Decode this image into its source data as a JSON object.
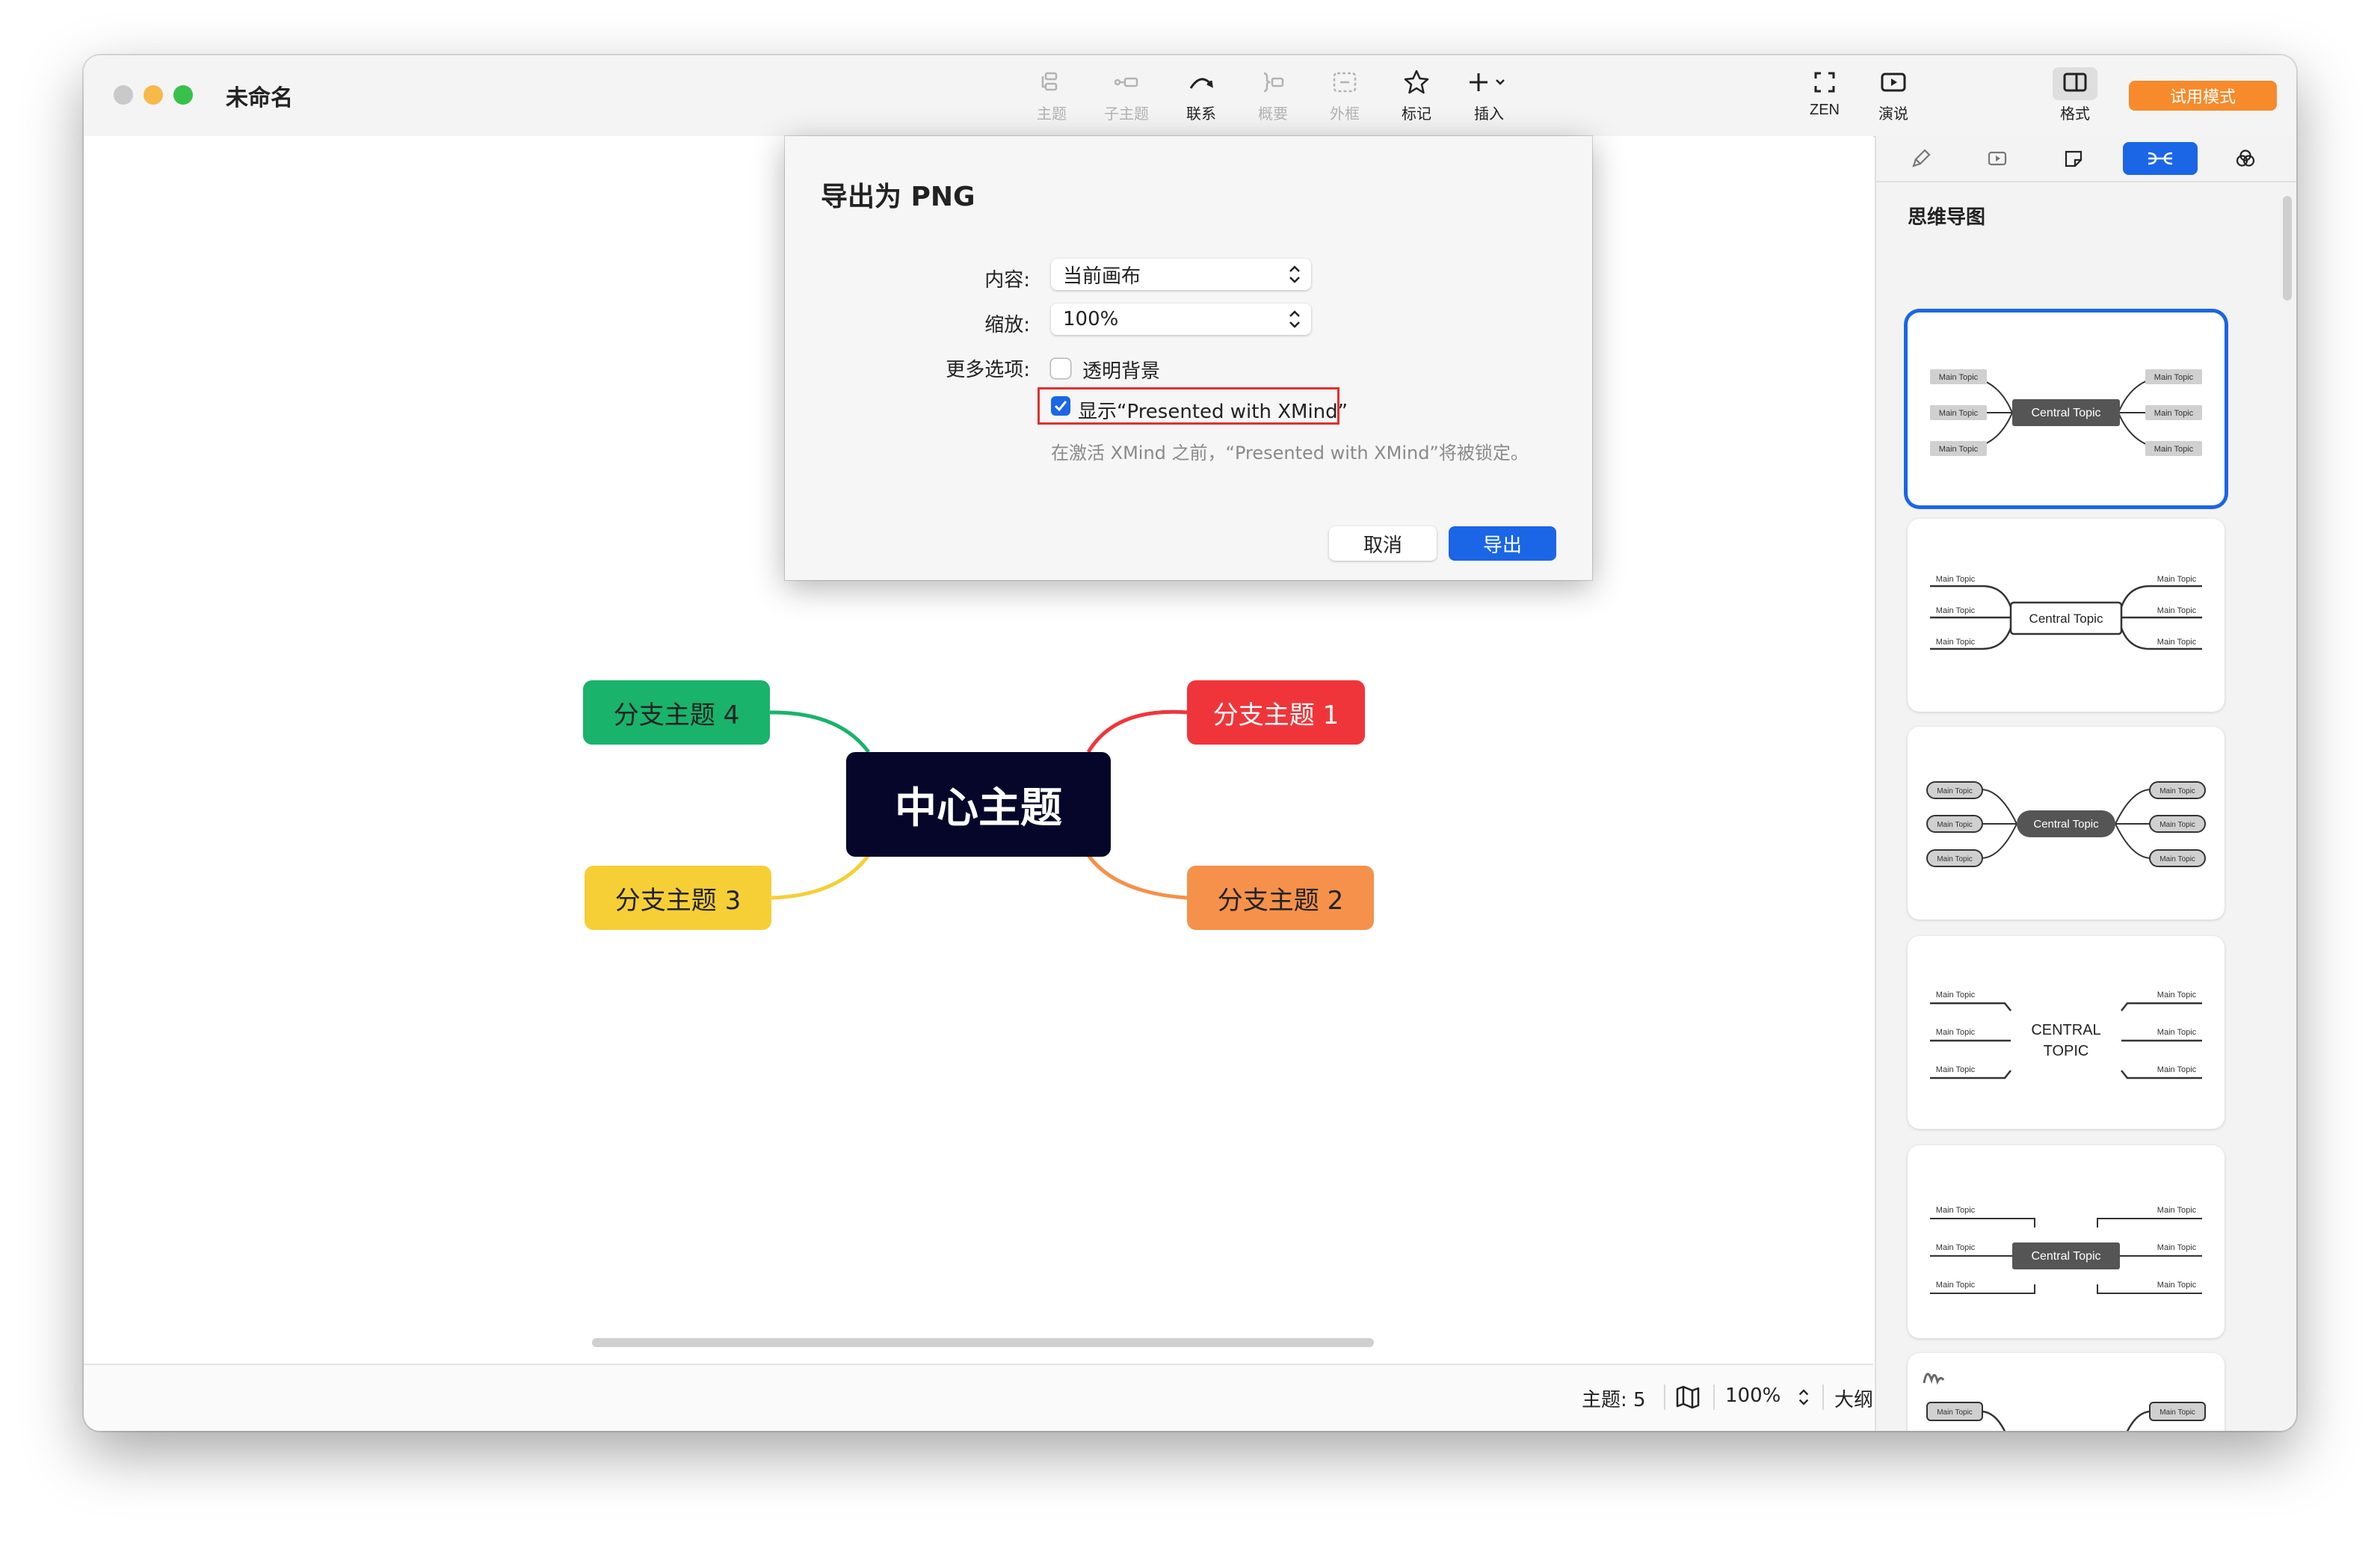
{
  "window": {
    "title": "未命名"
  },
  "toolbar": {
    "items": [
      {
        "label": "主题",
        "enabled": false,
        "icon": "topic-icon"
      },
      {
        "label": "子主题",
        "enabled": false,
        "icon": "subtopic-icon"
      },
      {
        "label": "联系",
        "enabled": true,
        "icon": "relationship-icon"
      },
      {
        "label": "概要",
        "enabled": false,
        "icon": "summary-icon"
      },
      {
        "label": "外框",
        "enabled": false,
        "icon": "boundary-icon"
      },
      {
        "label": "标记",
        "enabled": true,
        "icon": "star-icon"
      },
      {
        "label": "插入",
        "enabled": true,
        "icon": "plus-icon"
      }
    ],
    "zen_label": "ZEN",
    "present_label": "演说",
    "format_label": "格式",
    "trial_label": "试用模式"
  },
  "mindmap": {
    "central": "中心主题",
    "branches": [
      {
        "label": "分支主题 1",
        "color": "#f0353a"
      },
      {
        "label": "分支主题 2",
        "color": "#f5914a"
      },
      {
        "label": "分支主题 3",
        "color": "#f6cf37"
      },
      {
        "label": "分支主题 4",
        "color": "#19b36b"
      }
    ]
  },
  "dialog": {
    "title": "导出为 PNG",
    "content_label": "内容:",
    "content_value": "当前画布",
    "scale_label": "缩放:",
    "scale_value": "100%",
    "more_label": "更多选项:",
    "transparent_label": "透明背景",
    "transparent_checked": false,
    "watermark_label": "显示“Presented with XMind”",
    "watermark_checked": true,
    "hint": "在激活 XMind 之前，“Presented with XMind”将被锁定。",
    "cancel_label": "取消",
    "export_label": "导出"
  },
  "statusbar": {
    "topics": "主题: 5",
    "zoom": "100%",
    "outline": "大纲"
  },
  "sidebar": {
    "title": "思维导图",
    "tabs": [
      "brush-icon",
      "play-icon",
      "sticker-icon",
      "structure-icon",
      "theme-icon"
    ],
    "active_tab": "structure-icon",
    "sample": {
      "central": "Central Topic",
      "central_caps": "CENTRAL TOPIC",
      "main": "Main Topic"
    }
  },
  "colors": {
    "accent": "#1a66e6",
    "trial": "#f78a2b",
    "highlight": "#e23030"
  }
}
